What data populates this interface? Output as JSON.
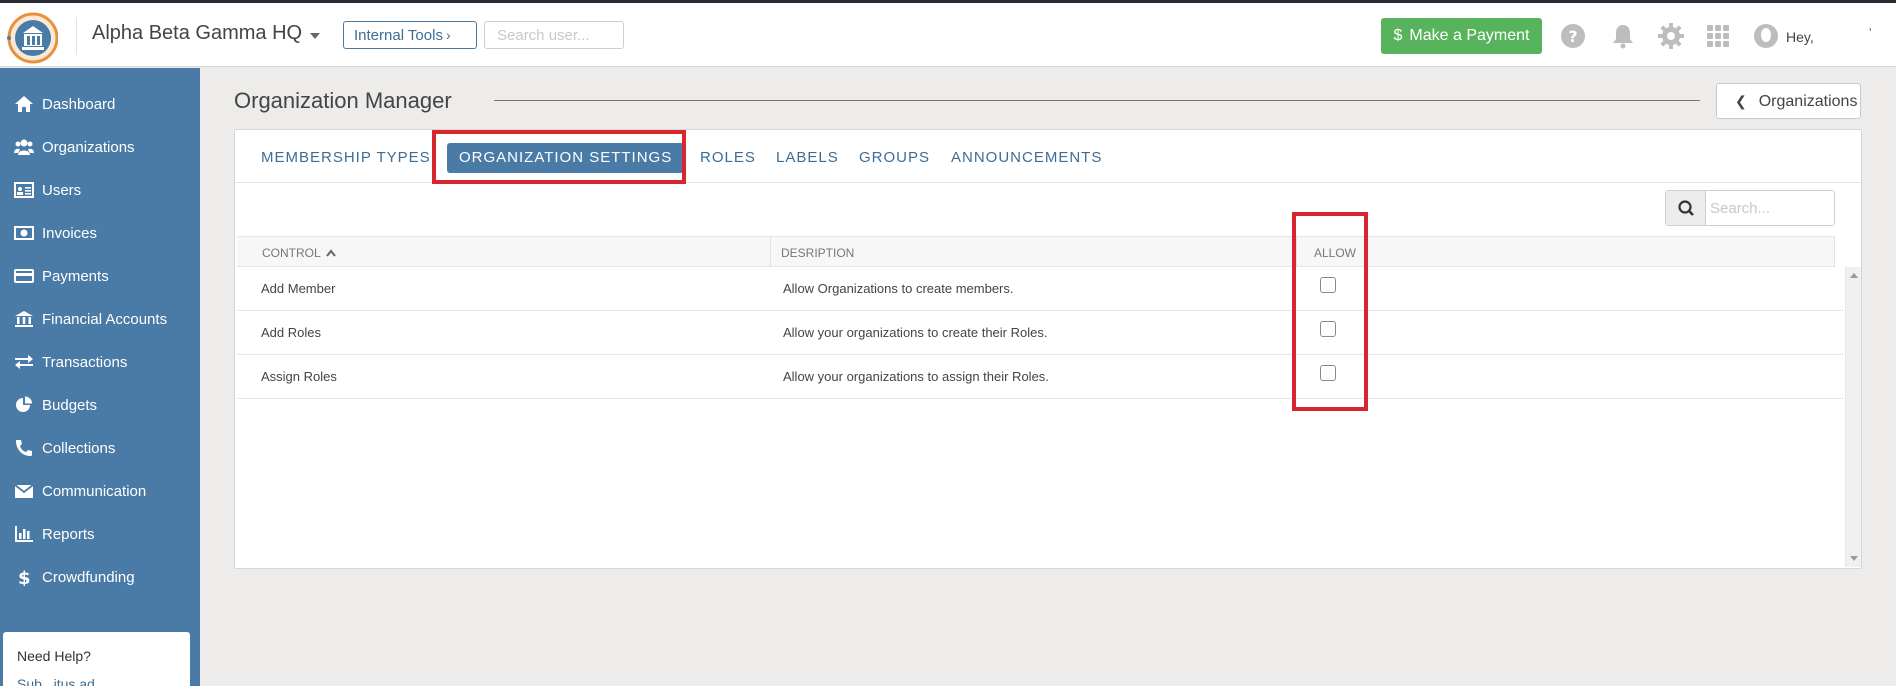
{
  "header": {
    "org_name": "Alpha Beta Gamma HQ",
    "internal_tools_label": "Internal Tools",
    "search_placeholder": "Search user...",
    "pay_label": "Make a Payment",
    "greeting": "Hey,",
    "trailing_mark": "ʼ"
  },
  "sidebar": {
    "items": [
      {
        "label": "Dashboard",
        "icon": "home-icon"
      },
      {
        "label": "Organizations",
        "icon": "users-icon"
      },
      {
        "label": "Users",
        "icon": "id-card-icon"
      },
      {
        "label": "Invoices",
        "icon": "money-icon"
      },
      {
        "label": "Payments",
        "icon": "credit-card-icon"
      },
      {
        "label": "Financial Accounts",
        "icon": "bank-icon"
      },
      {
        "label": "Transactions",
        "icon": "exchange-icon"
      },
      {
        "label": "Budgets",
        "icon": "pie-chart-icon"
      },
      {
        "label": "Collections",
        "icon": "phone-icon"
      },
      {
        "label": "Communication",
        "icon": "envelope-icon"
      },
      {
        "label": "Reports",
        "icon": "bar-chart-icon"
      },
      {
        "label": "Crowdfunding",
        "icon": "dollar-icon"
      }
    ],
    "help_title": "Need Help?",
    "help_link": "Sub...itus ad..."
  },
  "main": {
    "title": "Organization Manager",
    "back_button_label": "Organizations",
    "tabs": [
      {
        "label": "MEMBERSHIP TYPES"
      },
      {
        "label": "ORGANIZATION SETTINGS",
        "active": true
      },
      {
        "label": "ROLES"
      },
      {
        "label": "LABELS"
      },
      {
        "label": "GROUPS"
      },
      {
        "label": "ANNOUNCEMENTS"
      }
    ],
    "search_placeholder": "Search...",
    "columns": {
      "control": "CONTROL",
      "description": "DESRIPTION",
      "allow": "ALLOW"
    },
    "rows": [
      {
        "control": "Add Member",
        "description": "Allow Organizations to create members.",
        "allow": false
      },
      {
        "control": "Add Roles",
        "description": "Allow your organizations to create their Roles.",
        "allow": false
      },
      {
        "control": "Assign Roles",
        "description": "Allow your organizations to assign their Roles.",
        "allow": false
      }
    ]
  },
  "colors": {
    "sidebar": "#4a7ba6",
    "pay_button": "#57b45d",
    "highlight": "#d7262e",
    "link": "#3d6d94"
  }
}
